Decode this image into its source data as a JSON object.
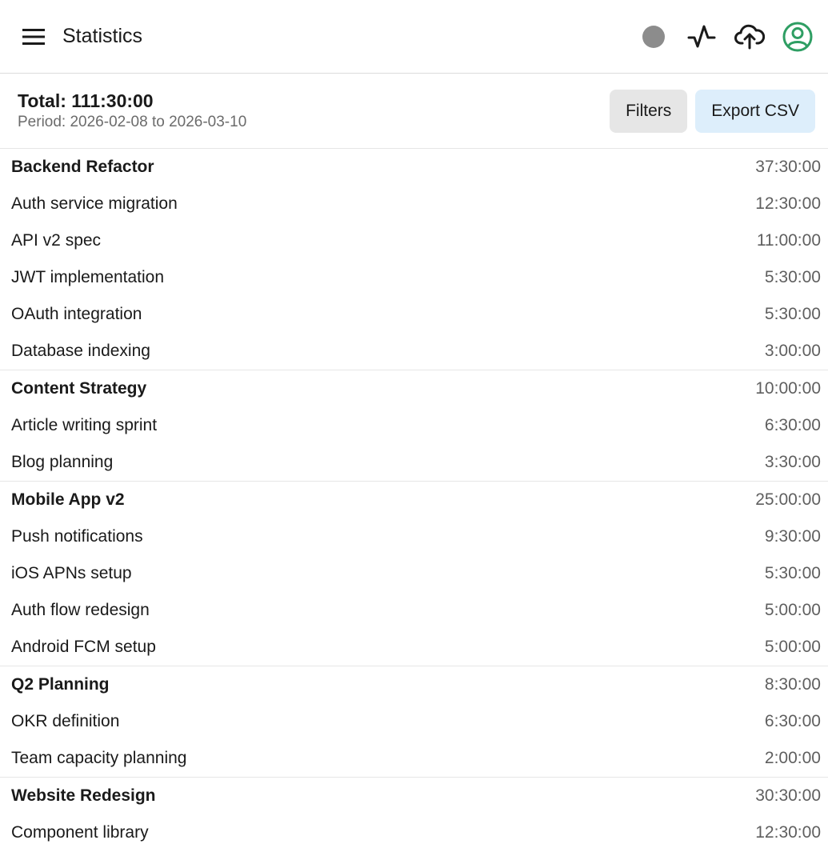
{
  "app_bar": {
    "title": "Statistics",
    "icons": [
      "menu-icon",
      "status-dot-icon",
      "activity-icon",
      "cloud-upload-icon",
      "account-icon"
    ],
    "colors": {
      "status_dot": "#8c8c8c",
      "account": "#2e9e63"
    }
  },
  "summary": {
    "total": "Total: 111:30:00",
    "period": "Period: 2026-02-08 to 2026-03-10",
    "filters_label": "Filters",
    "export_label": "Export CSV",
    "colors": {
      "filters_bg": "#e6e6e6",
      "export_bg": "#ddeefb"
    }
  },
  "groups": [
    {
      "name": "Backend Refactor",
      "duration": "37:30:00",
      "items": [
        {
          "name": "Auth service migration",
          "duration": "12:30:00"
        },
        {
          "name": "API v2 spec",
          "duration": "11:00:00"
        },
        {
          "name": "JWT implementation",
          "duration": "5:30:00"
        },
        {
          "name": "OAuth integration",
          "duration": "5:30:00"
        },
        {
          "name": "Database indexing",
          "duration": "3:00:00"
        }
      ]
    },
    {
      "name": "Content Strategy",
      "duration": "10:00:00",
      "items": [
        {
          "name": "Article writing sprint",
          "duration": "6:30:00"
        },
        {
          "name": "Blog planning",
          "duration": "3:30:00"
        }
      ]
    },
    {
      "name": "Mobile App v2",
      "duration": "25:00:00",
      "items": [
        {
          "name": "Push notifications",
          "duration": "9:30:00"
        },
        {
          "name": "iOS APNs setup",
          "duration": "5:30:00"
        },
        {
          "name": "Auth flow redesign",
          "duration": "5:00:00"
        },
        {
          "name": "Android FCM setup",
          "duration": "5:00:00"
        }
      ]
    },
    {
      "name": "Q2 Planning",
      "duration": "8:30:00",
      "items": [
        {
          "name": "OKR definition",
          "duration": "6:30:00"
        },
        {
          "name": "Team capacity planning",
          "duration": "2:00:00"
        }
      ]
    },
    {
      "name": "Website Redesign",
      "duration": "30:30:00",
      "items": [
        {
          "name": "Component library",
          "duration": "12:30:00"
        }
      ]
    }
  ]
}
